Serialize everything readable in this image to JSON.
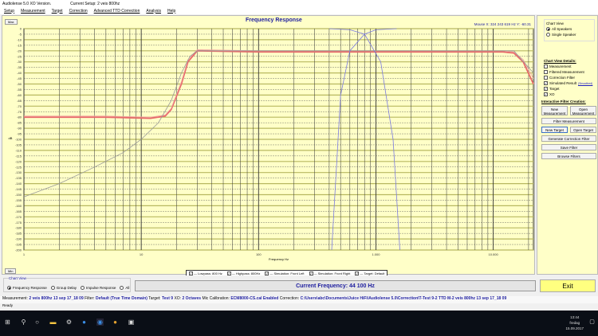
{
  "window": {
    "title": "Audiolense 5.0 XO Version.",
    "setup": "Current Setup: 2 veis 800hz"
  },
  "menu": [
    "Setup",
    "Measurement",
    "Target",
    "Correction",
    "Advanced TTD Correction",
    "Analysis",
    "Help"
  ],
  "chart": {
    "max_btn": "Max",
    "min_btn": "Min",
    "mouse_readout": "Mouse X: 324 243 619 Hz   Y: -60.31"
  },
  "legend": [
    {
      "label": "— Lowpass: 800 Hz",
      "checked": true
    },
    {
      "label": "— Highpass: 800Hz",
      "checked": true
    },
    {
      "label": "— Simulation: Front Left",
      "checked": true
    },
    {
      "label": "— Simulation: Front Right",
      "checked": true
    },
    {
      "label": "— Target: Default",
      "checked": true
    }
  ],
  "chart_data": {
    "type": "line",
    "title": "Frequency Response",
    "xlabel": "Frequency Hz",
    "ylabel": "dB",
    "xscale": "log",
    "xlim": [
      1,
      22000
    ],
    "ylim": [
      -200,
      0
    ],
    "xticks": [
      {
        "v": 1,
        "l": "1"
      },
      {
        "v": 10,
        "l": "10"
      },
      {
        "v": 100,
        "l": "100"
      },
      {
        "v": 1000,
        "l": "1.000"
      },
      {
        "v": 10000,
        "l": "10.000"
      }
    ],
    "yticks": [
      0,
      -5,
      -10,
      -15,
      -20,
      -25,
      -30,
      -35,
      -40,
      -45,
      -50,
      -55,
      -60,
      -65,
      -70,
      -75,
      -80,
      -85,
      -90,
      -95,
      -100,
      -105,
      -110,
      -115,
      -120,
      -125,
      -130,
      -135,
      -140,
      -145,
      -150,
      -155,
      -160,
      -165,
      -170,
      -175,
      -180,
      -185,
      -190,
      -195,
      -200
    ],
    "series": [
      {
        "name": "Simulation: Front Left",
        "color": "#e86a6a",
        "x": [
          1,
          5,
          12,
          16,
          18,
          22,
          25,
          30,
          100,
          1000,
          5000,
          12000,
          15000,
          18000,
          22000
        ],
        "y": [
          -80,
          -80,
          -81,
          -79,
          -73,
          -50,
          -30,
          -20,
          -21,
          -21,
          -21,
          -21,
          -22,
          -30,
          -50
        ]
      },
      {
        "name": "Simulation: Front Right",
        "color": "#f0a0a0",
        "x": [
          1,
          5,
          12,
          16,
          18,
          22,
          25,
          30,
          100,
          1000,
          5000,
          12000,
          15000,
          18000,
          22000
        ],
        "y": [
          -79,
          -79,
          -80,
          -78,
          -72,
          -48,
          -28,
          -19,
          -20,
          -20,
          -20,
          -20,
          -21,
          -28,
          -45
        ]
      },
      {
        "name": "Target: Default",
        "color": "#999999",
        "x": [
          1,
          2,
          4,
          7,
          10,
          14,
          18,
          22,
          26,
          30,
          100,
          15000,
          22000
        ],
        "y": [
          -152,
          -140,
          -125,
          -112,
          -100,
          -85,
          -65,
          -40,
          -25,
          -20,
          -20,
          -20,
          -40
        ]
      },
      {
        "name": "Highpass: 800Hz",
        "color": "#7a7ae0",
        "x": [
          420,
          500,
          600,
          800,
          1000,
          1500
        ],
        "y": [
          -200,
          -60,
          -20,
          -5,
          -1,
          0
        ]
      },
      {
        "name": "Lowpass: 800 Hz",
        "color": "#7a7ae0",
        "x": [
          400,
          600,
          800,
          1100,
          1400,
          1600
        ],
        "y": [
          0,
          -1,
          -5,
          -30,
          -100,
          -200
        ]
      }
    ]
  },
  "right": {
    "chart_view": "Chart View",
    "all": "All Speakers",
    "single": "Single Speaker",
    "details_head": "Chart View Details:",
    "details": [
      {
        "label": "Measurement",
        "checked": false
      },
      {
        "label": "Filtered Measurement",
        "checked": false
      },
      {
        "label": "Correction Filter",
        "checked": false
      },
      {
        "label": "Simulated Result",
        "checked": true
      },
      {
        "label": "Target",
        "checked": true
      },
      {
        "label": "XO",
        "checked": true
      }
    ],
    "smoothed": "(Smoothed)",
    "ifc_head": "Interactive Filter Creation:",
    "new_meas": "New Measurement",
    "open_meas": "Open Measurement",
    "filter_meas": "Filter Measurement",
    "new_target": "New Target",
    "open_target": "Open Target",
    "gen_corr": "Generate Correction Filter",
    "save_filter": "Save Filter",
    "browse": "Browse Filters"
  },
  "bottom": {
    "cv_label": "Chart View",
    "opts": [
      {
        "label": "Frequency Response",
        "on": true
      },
      {
        "label": "Group Delay",
        "on": false
      },
      {
        "label": "Impulse Response",
        "on": false
      },
      {
        "label": "All",
        "on": false
      }
    ],
    "current_freq": "Current Frequency: 44 100 Hz",
    "exit": "Exit"
  },
  "info": {
    "meas_l": "Measurement:",
    "meas": "2 veis 800hz 13 sep 17_18 09",
    "filter_l": "Filter:",
    "filter": "Default (True Time Domain)",
    "target_l": "Target:",
    "target": "Test 9",
    "xo_l": "XO:",
    "xo": "2 Octaves",
    "mic_l": "Mic Calibration:",
    "mic": "ECM8000-CS.cal Enabled",
    "corr_l": "Correction:",
    "corr": "C:\\Users\\abc\\Documents\\Juice HiFi\\Audiolense 5.0\\Correction\\T-Test 9-2 TTD M-2 veis 800hz 13 sep 17_18 09"
  },
  "status": "Ready",
  "taskbar": {
    "time": "13:44",
    "day": "fredag",
    "date": "15.09.2017"
  }
}
